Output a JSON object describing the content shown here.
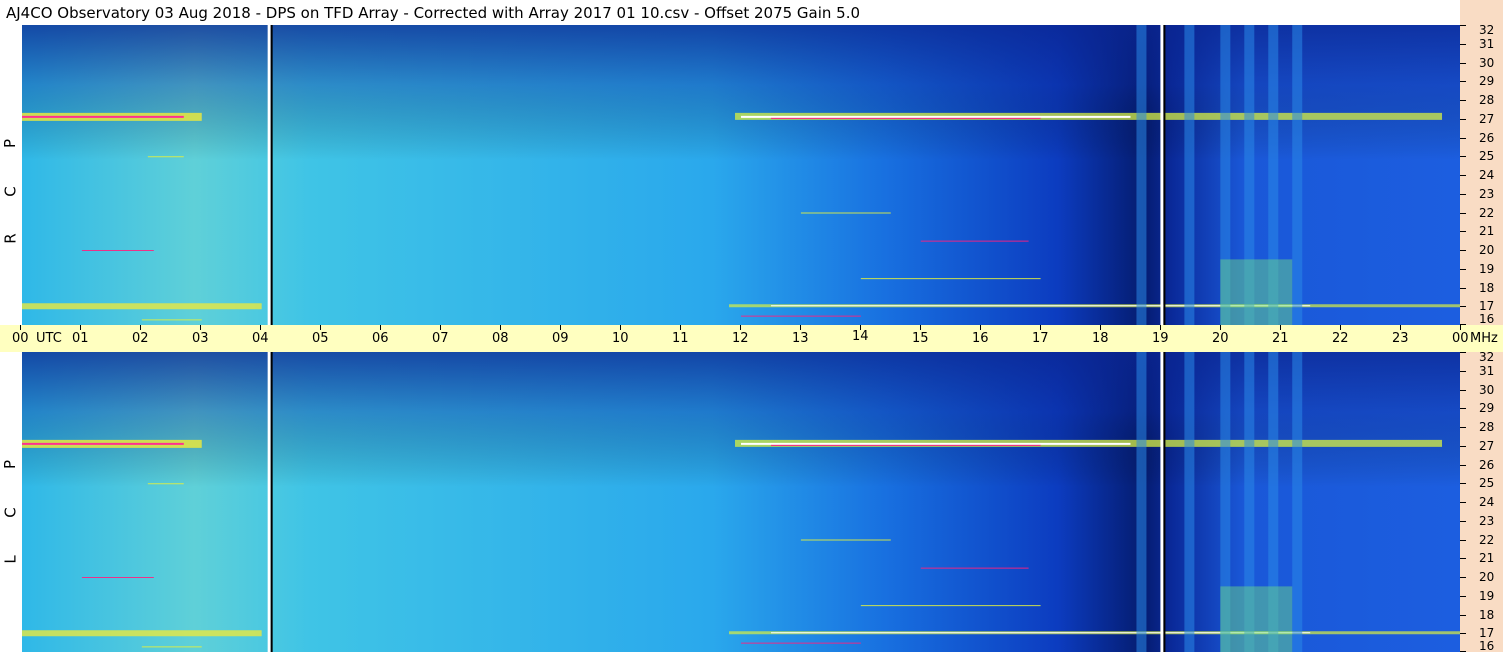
{
  "title": "AJ4CO Observatory  03 Aug 2018  -  DPS on TFD Array  -  Corrected with Array 2017 01 10.csv  -  Offset 2075  Gain 5.0",
  "panels": [
    {
      "label_letters": [
        "R",
        "C",
        "P"
      ]
    },
    {
      "label_letters": [
        "L",
        "C",
        "P"
      ]
    }
  ],
  "time_axis": {
    "labels": [
      "00",
      "01",
      "02",
      "03",
      "04",
      "05",
      "06",
      "07",
      "08",
      "09",
      "10",
      "11",
      "12",
      "13",
      "14",
      "15",
      "16",
      "17",
      "18",
      "19",
      "20",
      "21",
      "22",
      "23",
      "00"
    ],
    "utc_label": "UTC",
    "mhz_label": "MHz"
  },
  "freq_axis": {
    "labels": [
      "32",
      "31",
      "30",
      "29",
      "28",
      "27",
      "26",
      "25",
      "24",
      "23",
      "22",
      "21",
      "20",
      "19",
      "18",
      "17",
      "16"
    ]
  },
  "colors": {
    "accent_panel_bg": "#f9dcc4",
    "time_axis_bg": "#ffffc0",
    "colormap": [
      "#000030",
      "#0020a0",
      "#1e5be8",
      "#1eb4ee",
      "#40e0c0",
      "#d8f040",
      "#ffa000",
      "#ff2080",
      "#ffffff"
    ]
  },
  "chart_data": {
    "type": "heatmap",
    "x_unit": "UTC hour",
    "y_unit": "MHz",
    "x_range": [
      0,
      24
    ],
    "y_range": [
      16,
      32
    ],
    "grid": false,
    "markers_hours": [
      4.1,
      19.0
    ],
    "features": {
      "strong_band_mhz": 27.1,
      "lower_band_mhz": 17.0,
      "night_quiet_region_hours": [
        17.0,
        19.0
      ],
      "broadband_columns_hours": [
        18.6,
        19.4,
        20.0,
        20.4,
        20.8,
        21.2
      ]
    }
  }
}
